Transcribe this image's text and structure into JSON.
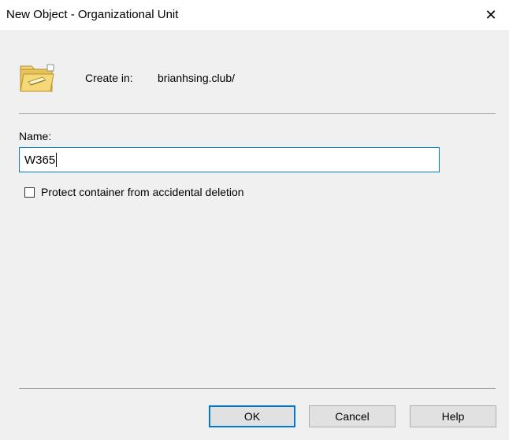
{
  "window": {
    "title": "New Object - Organizational Unit",
    "close_icon": "close-icon",
    "close_glyph": "✕"
  },
  "header": {
    "icon": "folder-icon",
    "create_in_label": "Create in:",
    "create_in_value": "brianhsing.club/"
  },
  "form": {
    "name_label": "Name:",
    "name_value": "W365",
    "protect_label": "Protect container from accidental deletion",
    "protect_checked": false
  },
  "buttons": {
    "ok": "OK",
    "cancel": "Cancel",
    "help": "Help"
  },
  "colors": {
    "accent": "#0078d7",
    "background": "#f0f0f0",
    "titlebar": "#ffffff"
  }
}
